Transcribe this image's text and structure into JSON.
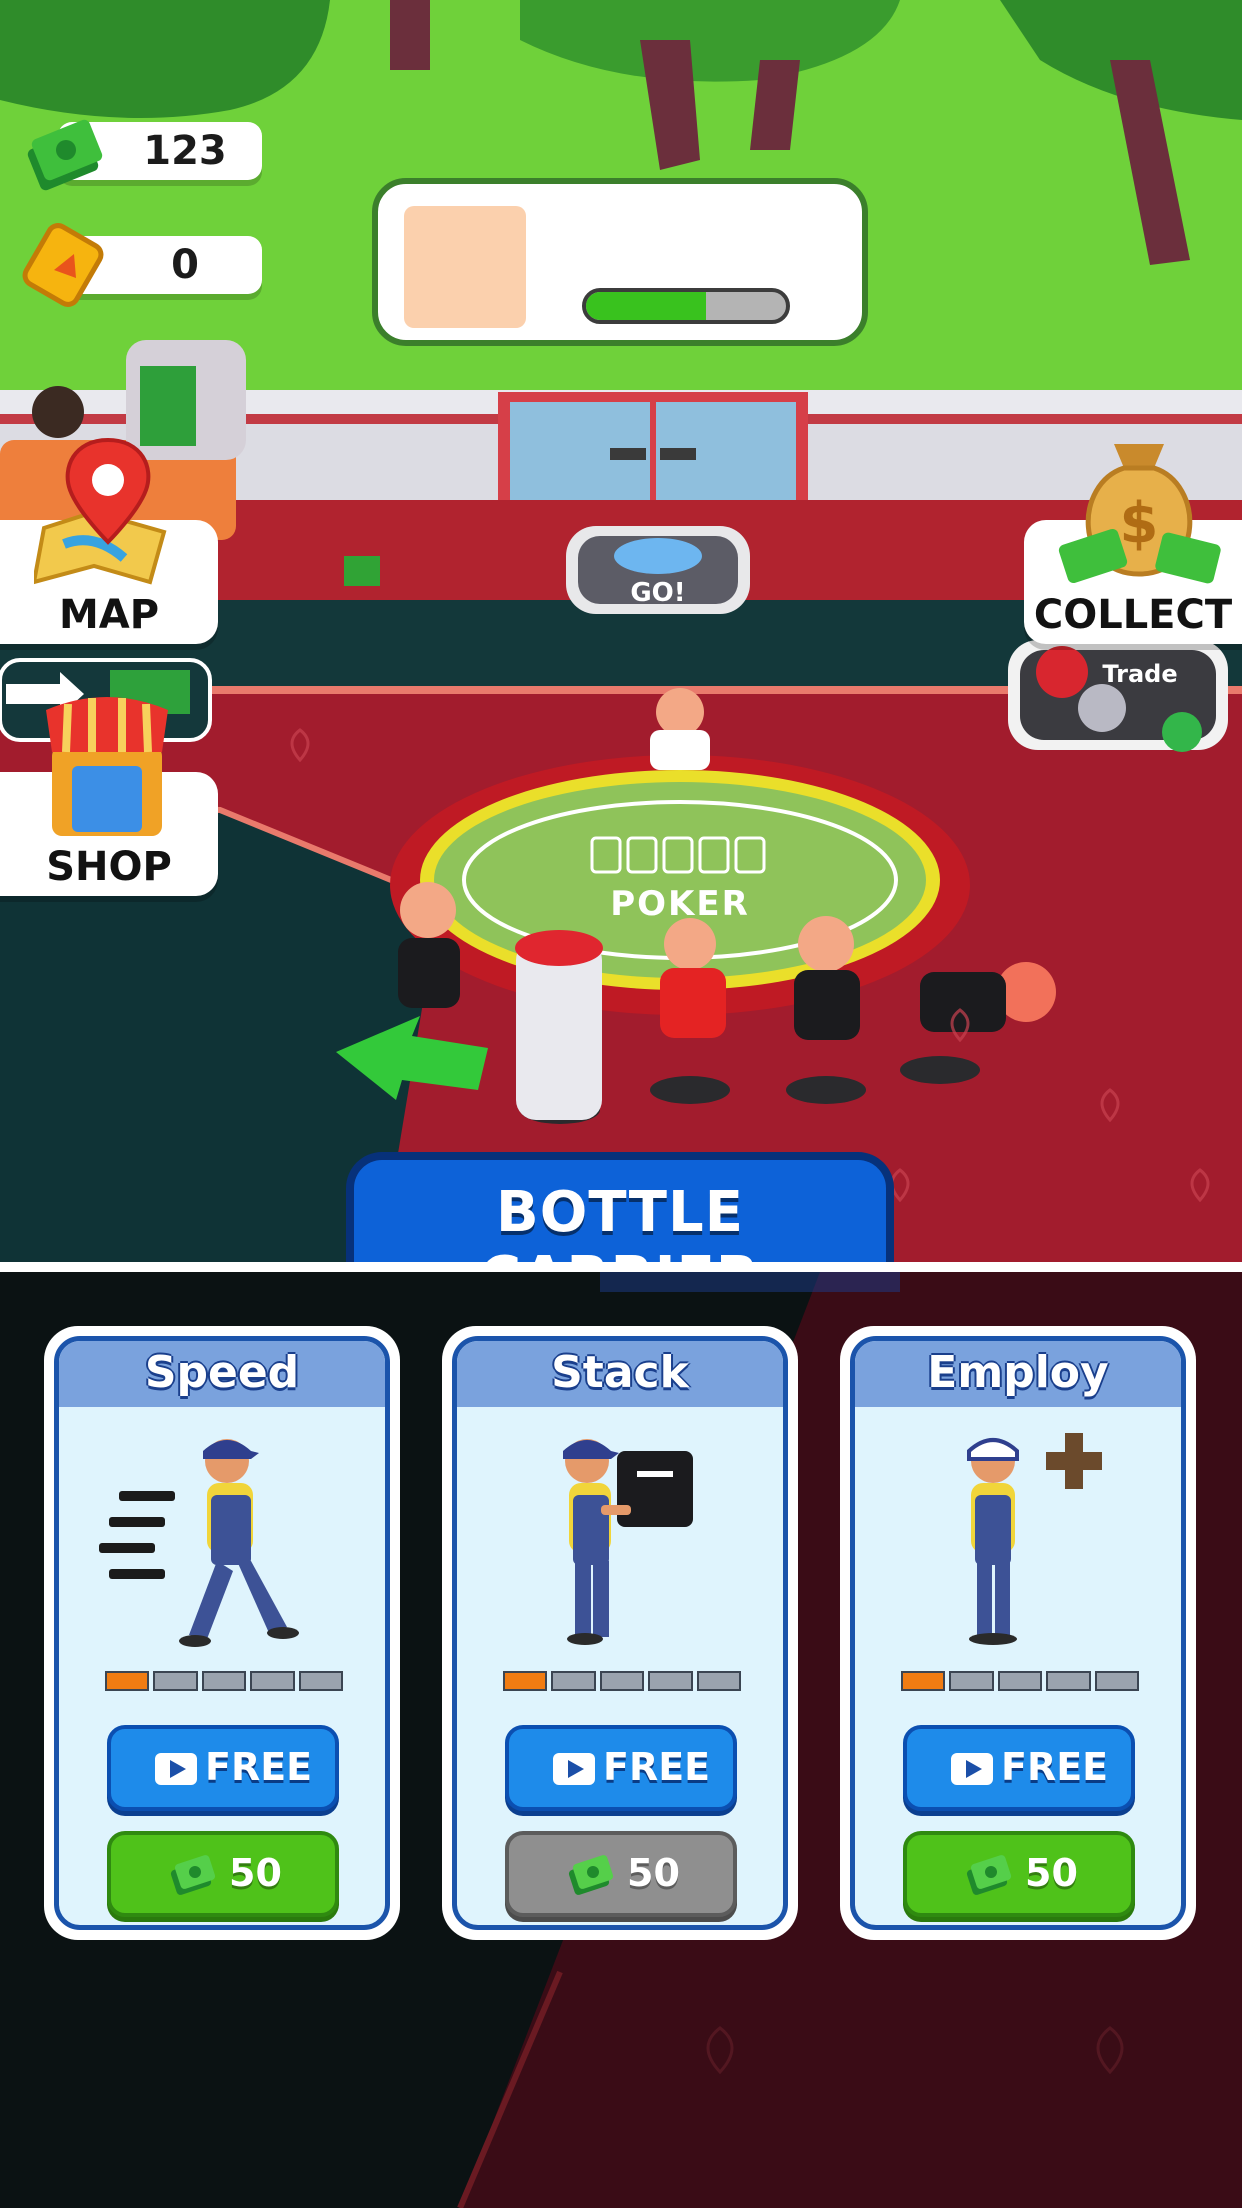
{
  "resources": {
    "cash": {
      "value": "123",
      "icon": "cash-stack-icon"
    },
    "tickets": {
      "value": "0",
      "icon": "ticket-icon"
    }
  },
  "top_panel": {
    "progress_fraction": 0.6,
    "swatch_color": "#fbd0ad",
    "bar_color": "#39c21e"
  },
  "side_buttons": {
    "map": {
      "label": "MAP",
      "icon": "map-pin-icon"
    },
    "shop": {
      "label": "SHOP",
      "icon": "shop-awning-icon"
    },
    "collect": {
      "label": "COLLECT",
      "icon": "money-bag-icon"
    }
  },
  "scene": {
    "go_pad_label": "GO!",
    "trade_label": "Trade",
    "table_label": "POKER"
  },
  "banner": {
    "title": "BOTTLE CARRIER"
  },
  "upgrades": [
    {
      "title": "Speed",
      "level": 1,
      "max_level": 5,
      "free_label": "FREE",
      "cost": "50",
      "cost_enabled": true,
      "icon": "running-worker-icon"
    },
    {
      "title": "Stack",
      "level": 1,
      "max_level": 5,
      "free_label": "FREE",
      "cost": "50",
      "cost_enabled": false,
      "icon": "worker-carrying-box-icon"
    },
    {
      "title": "Employ",
      "level": 1,
      "max_level": 5,
      "free_label": "FREE",
      "cost": "50",
      "cost_enabled": true,
      "icon": "worker-plus-icon"
    }
  ],
  "colors": {
    "accent_blue": "#1e8bea",
    "accent_green": "#4fc21a",
    "disabled_gray": "#8f8f8f",
    "level_on": "#f07c12"
  }
}
